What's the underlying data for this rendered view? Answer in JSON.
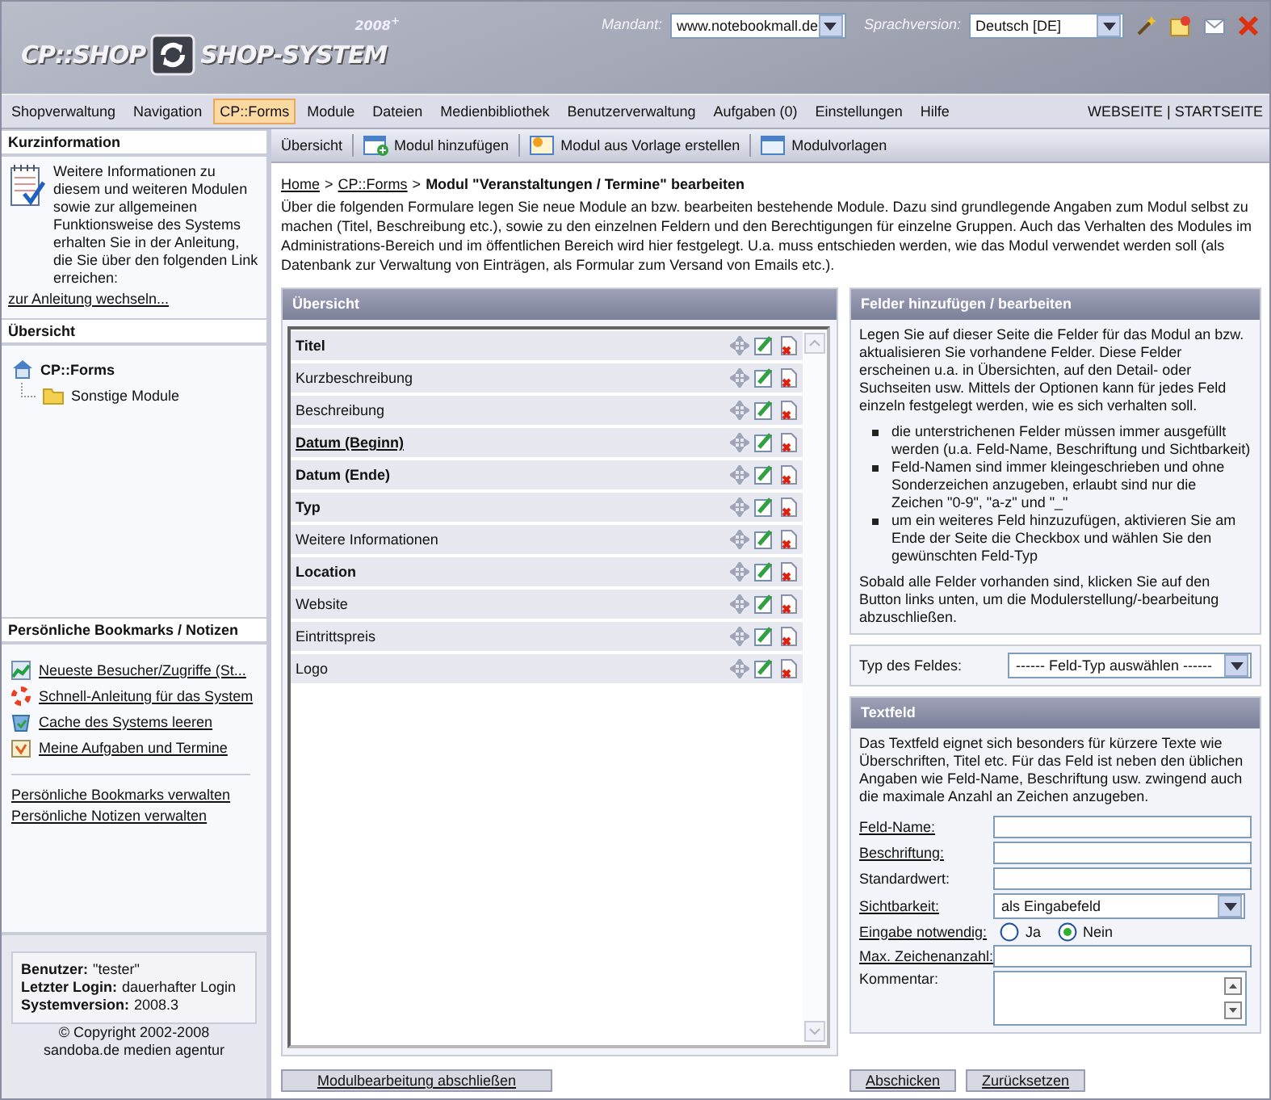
{
  "header": {
    "logo_left": "CP::SHOP",
    "logo_right": "SHOP-SYSTEM",
    "version": "2008$^{+}$",
    "client_label": "Mandant:",
    "client_value": "www.notebookmall.de",
    "language_label": "Sprachversion:",
    "language_value": "Deutsch [DE]",
    "tools": [
      {
        "kind": "wand"
      },
      {
        "kind": "note"
      },
      {
        "kind": "mail"
      },
      {
        "kind": "close"
      }
    ]
  },
  "menu": [
    {
      "label": "Shopverwaltung",
      "selected": false
    },
    {
      "label": "Navigation",
      "selected": false
    },
    {
      "label": "CP::Forms",
      "selected": true
    },
    {
      "label": "Module",
      "selected": false
    },
    {
      "label": "Dateien",
      "selected": false
    },
    {
      "label": "Medienbibliothek",
      "selected": false
    },
    {
      "label": "Benutzerverwaltung",
      "selected": false
    },
    {
      "label": "Aufgaben (0)",
      "selected": false
    },
    {
      "label": "Einstellungen",
      "selected": false
    },
    {
      "label": "Hilfe",
      "selected": false
    }
  ],
  "menu_right": "WEBSEITE | STARTSEITE",
  "sidebar": {
    "info_title": "Kurzinformation",
    "info_text": "Weitere Informationen zu diesem und weiteren Modulen sowie zur allgemeinen Funktionsweise des Systems erhalten Sie in der Anleitung, die Sie über den folgenden Link erreichen:",
    "info_link": "zur Anleitung wechseln...",
    "overview_title": "Übersicht",
    "tree": [
      {
        "label": "CP::Forms",
        "kind": "root",
        "children": [
          {
            "label": "Sonstige Module",
            "kind": "folder"
          }
        ]
      }
    ],
    "bookmarks_title": "Persönliche Bookmarks / Notizen",
    "bookmarks": [
      {
        "label": "Neueste Besucher/Zugriffe (St...",
        "kind": "chart"
      },
      {
        "label": "Schnell-Anleitung für das System",
        "kind": "help"
      },
      {
        "label": "Cache des Systems leeren",
        "kind": "bin"
      },
      {
        "label": "Meine Aufgaben und Termine",
        "kind": "calendar"
      }
    ],
    "manage_links": [
      "Persönliche Bookmarks verwalten",
      "Persönliche Notizen verwalten"
    ],
    "user_info": [
      {
        "label": "Benutzer:",
        "value": "\"tester\""
      },
      {
        "label": "Letzter Login:",
        "value": "dauerhafter Login"
      },
      {
        "label": "Systemversion:",
        "value": "2008.3"
      }
    ],
    "copyright": [
      "© Copyright 2002-2008",
      "sandoba.de medien agentur"
    ]
  },
  "toolbar": [
    {
      "label": "Übersicht",
      "kind": "text"
    },
    {
      "label": "Modul hinzufügen",
      "kind": "add"
    },
    {
      "label": "Modul aus Vorlage erstellen",
      "kind": "template"
    },
    {
      "label": "Modulvorlagen",
      "kind": "window"
    }
  ],
  "breadcrumb": {
    "links": [
      "Home",
      "CP::Forms"
    ],
    "separator": ">",
    "current": "Modul \"Veranstaltungen / Termine\" bearbeiten"
  },
  "description": "Über die folgenden Formulare legen Sie neue Module an bzw. bearbeiten bestehende Module. Dazu sind grundlegende Angaben zum Modul selbst zu machen (Titel, Beschreibung etc.), sowie zu den einzelnen Feldern und den Berechtigungen für einzelne Gruppen. Auch das Verhalten des Modules im Administrations-Bereich und im öffentlichen Bereich wird hier festgelegt. U.a. muss entschieden werden, wie das Modul verwendet werden soll (als Datenbank zur Verwaltung von Einträgen, als Formular zum Versand von Emails etc.).",
  "overview": {
    "title": "Übersicht",
    "fields": [
      {
        "label": "Titel",
        "bold": true,
        "underlined": false
      },
      {
        "label": "Kurzbeschreibung",
        "bold": false,
        "underlined": false
      },
      {
        "label": "Beschreibung",
        "bold": false,
        "underlined": false
      },
      {
        "label": "Datum (Beginn)",
        "bold": true,
        "underlined": true
      },
      {
        "label": "Datum (Ende)",
        "bold": true,
        "underlined": false
      },
      {
        "label": "Typ",
        "bold": true,
        "underlined": false
      },
      {
        "label": "Weitere Informationen",
        "bold": false,
        "underlined": false
      },
      {
        "label": "Location",
        "bold": true,
        "underlined": false
      },
      {
        "label": "Website",
        "bold": false,
        "underlined": false
      },
      {
        "label": "Eintrittspreis",
        "bold": false,
        "underlined": false
      },
      {
        "label": "Logo",
        "bold": false,
        "underlined": false
      }
    ],
    "finish_button": "Modulbearbeitung abschließen"
  },
  "fields_panel": {
    "title": "Felder hinzufügen / bearbeiten",
    "intro": "Legen Sie auf dieser Seite die Felder für das Modul an bzw. aktualisieren Sie vorhandene Felder. Diese Felder erscheinen u.a. in Übersichten, auf den Detail- oder Suchseiten usw. Mittels der Optionen kann für jedes Feld einzeln festgelegt werden, wie es sich verhalten soll.",
    "bullets": [
      "die unterstrichenen Felder müssen immer ausgefüllt werden (u.a. Feld-Name, Beschriftung und Sichtbarkeit)",
      "Feld-Namen sind immer kleingeschrieben und ohne Sonderzeichen anzugeben, erlaubt sind nur die Zeichen \"0-9\", \"a-z\" und \"_\"",
      "um ein weiteres Feld hinzuzufügen, aktivieren Sie am Ende der Seite die Checkbox und wählen Sie den gewünschten Feld-Typ"
    ],
    "outro": "Sobald alle Felder vorhanden sind, klicken Sie auf den Button links unten, um die Modulerstellung/-bearbeitung abzuschließen."
  },
  "type_select": {
    "label": "Typ des Feldes:",
    "value": "------ Feld-Typ auswählen ------"
  },
  "textfield": {
    "title": "Textfeld",
    "text": "Das Textfeld eignet sich besonders für kürzere Texte wie Überschriften, Titel etc. Für das Feld ist neben den üblichen Angaben wie Feld-Name, Beschriftung usw. zwingend auch die maximale Anzahl an Zeichen anzugeben.",
    "rows": [
      {
        "label": "Feld-Name:",
        "required": true,
        "kind": "text"
      },
      {
        "label": "Beschriftung:",
        "required": true,
        "kind": "text"
      },
      {
        "label": "Standardwert:",
        "required": false,
        "kind": "text"
      },
      {
        "label": "Sichtbarkeit:",
        "required": true,
        "kind": "select",
        "value": "als Eingabefeld"
      },
      {
        "label": "Eingabe notwendig:",
        "required": true,
        "kind": "radio",
        "options": [
          {
            "label": "Ja",
            "selected": false
          },
          {
            "label": "Nein",
            "selected": true
          }
        ]
      },
      {
        "label": "Max. Zeichenanzahl:",
        "required": true,
        "kind": "text"
      },
      {
        "label": "Kommentar:",
        "required": false,
        "kind": "textarea"
      }
    ]
  },
  "form_buttons": [
    "Abschicken",
    "Zurücksetzen"
  ]
}
